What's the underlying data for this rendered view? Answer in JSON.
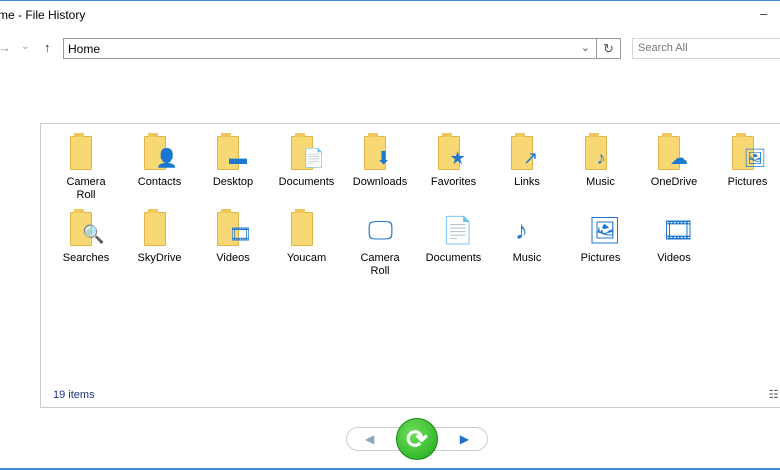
{
  "window": {
    "title": "me - File History",
    "minimize": "–"
  },
  "toolbar": {
    "forward": "→",
    "recent": "⌄",
    "up": "↑",
    "address": "Home",
    "address_dropdown": "⌄",
    "refresh": "↻",
    "search_placeholder": "Search All"
  },
  "items": [
    {
      "label": "Camera Roll",
      "badge": ""
    },
    {
      "label": "Contacts",
      "badge": "👤"
    },
    {
      "label": "Desktop",
      "badge": "▬"
    },
    {
      "label": "Documents",
      "badge": "📄"
    },
    {
      "label": "Downloads",
      "badge": "⬇"
    },
    {
      "label": "Favorites",
      "badge": "★"
    },
    {
      "label": "Links",
      "badge": "↗"
    },
    {
      "label": "Music",
      "badge": "♪"
    },
    {
      "label": "OneDrive",
      "badge": "☁"
    },
    {
      "label": "Pictures",
      "badge": "🖼"
    },
    {
      "label": "Searches",
      "badge": "🔍"
    },
    {
      "label": "SkyDrive",
      "badge": ""
    },
    {
      "label": "Videos",
      "badge": "🎞"
    },
    {
      "label": "Youcam",
      "badge": ""
    },
    {
      "label": "Camera Roll",
      "badge": "🖵",
      "library": true
    },
    {
      "label": "Documents",
      "badge": "📄",
      "library": true
    },
    {
      "label": "Music",
      "badge": "♪",
      "library": true
    },
    {
      "label": "Pictures",
      "badge": "🖼",
      "library": true
    },
    {
      "label": "Videos",
      "badge": "🎞",
      "library": true
    }
  ],
  "status": {
    "count": "19 items",
    "details_view": "☷",
    "icons_view": "▣"
  },
  "controls": {
    "previous": "◀",
    "restore": "⟳",
    "next": "▶"
  }
}
